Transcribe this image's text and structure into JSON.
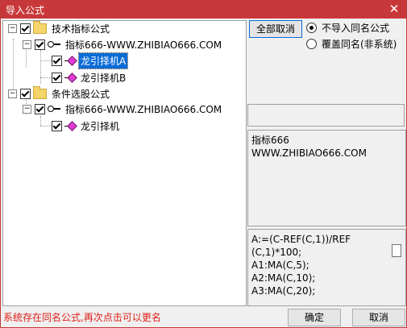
{
  "window": {
    "title": "导入公式",
    "close_glyph": "✕"
  },
  "tree": {
    "groups": [
      {
        "label": "技术指标公式",
        "expander": "−",
        "checked": true,
        "children": [
          {
            "label": "指标666-WWW.ZHIBIAO666.COM",
            "expander": "−",
            "checked": true,
            "items": [
              {
                "label": "龙引择机A",
                "checked": true,
                "selected": true
              },
              {
                "label": "龙引择机B",
                "checked": true,
                "selected": false
              }
            ]
          }
        ]
      },
      {
        "label": "条件选股公式",
        "expander": "−",
        "checked": true,
        "children": [
          {
            "label": "指标666-WWW.ZHIBIAO666.COM",
            "expander": "−",
            "checked": true,
            "items": [
              {
                "label": "龙引择机",
                "checked": true,
                "selected": false
              }
            ]
          }
        ]
      }
    ]
  },
  "controls": {
    "cancel_all_label": "全部取消",
    "options": [
      {
        "label": "不导入同名公式",
        "selected": true
      },
      {
        "label": "覆盖同名(非系统)",
        "selected": false
      }
    ]
  },
  "info_panel": {
    "text": "指标666\nWWW.ZHIBIAO666.COM"
  },
  "formula_panel": {
    "text": "A:=(C-REF(C,1))/REF\n(C,1)*100;\nA1:MA(C,5);\nA2:MA(C,10);\nA3:MA(C,20);"
  },
  "status": {
    "message": "系统存在同名公式,再次点击可以更名"
  },
  "footer": {
    "ok_label": "确定",
    "cancel_label": "取消"
  },
  "colors": {
    "title_bar": "#c8383a",
    "status_text": "#e0201a",
    "selection": "#0a6bd6"
  }
}
